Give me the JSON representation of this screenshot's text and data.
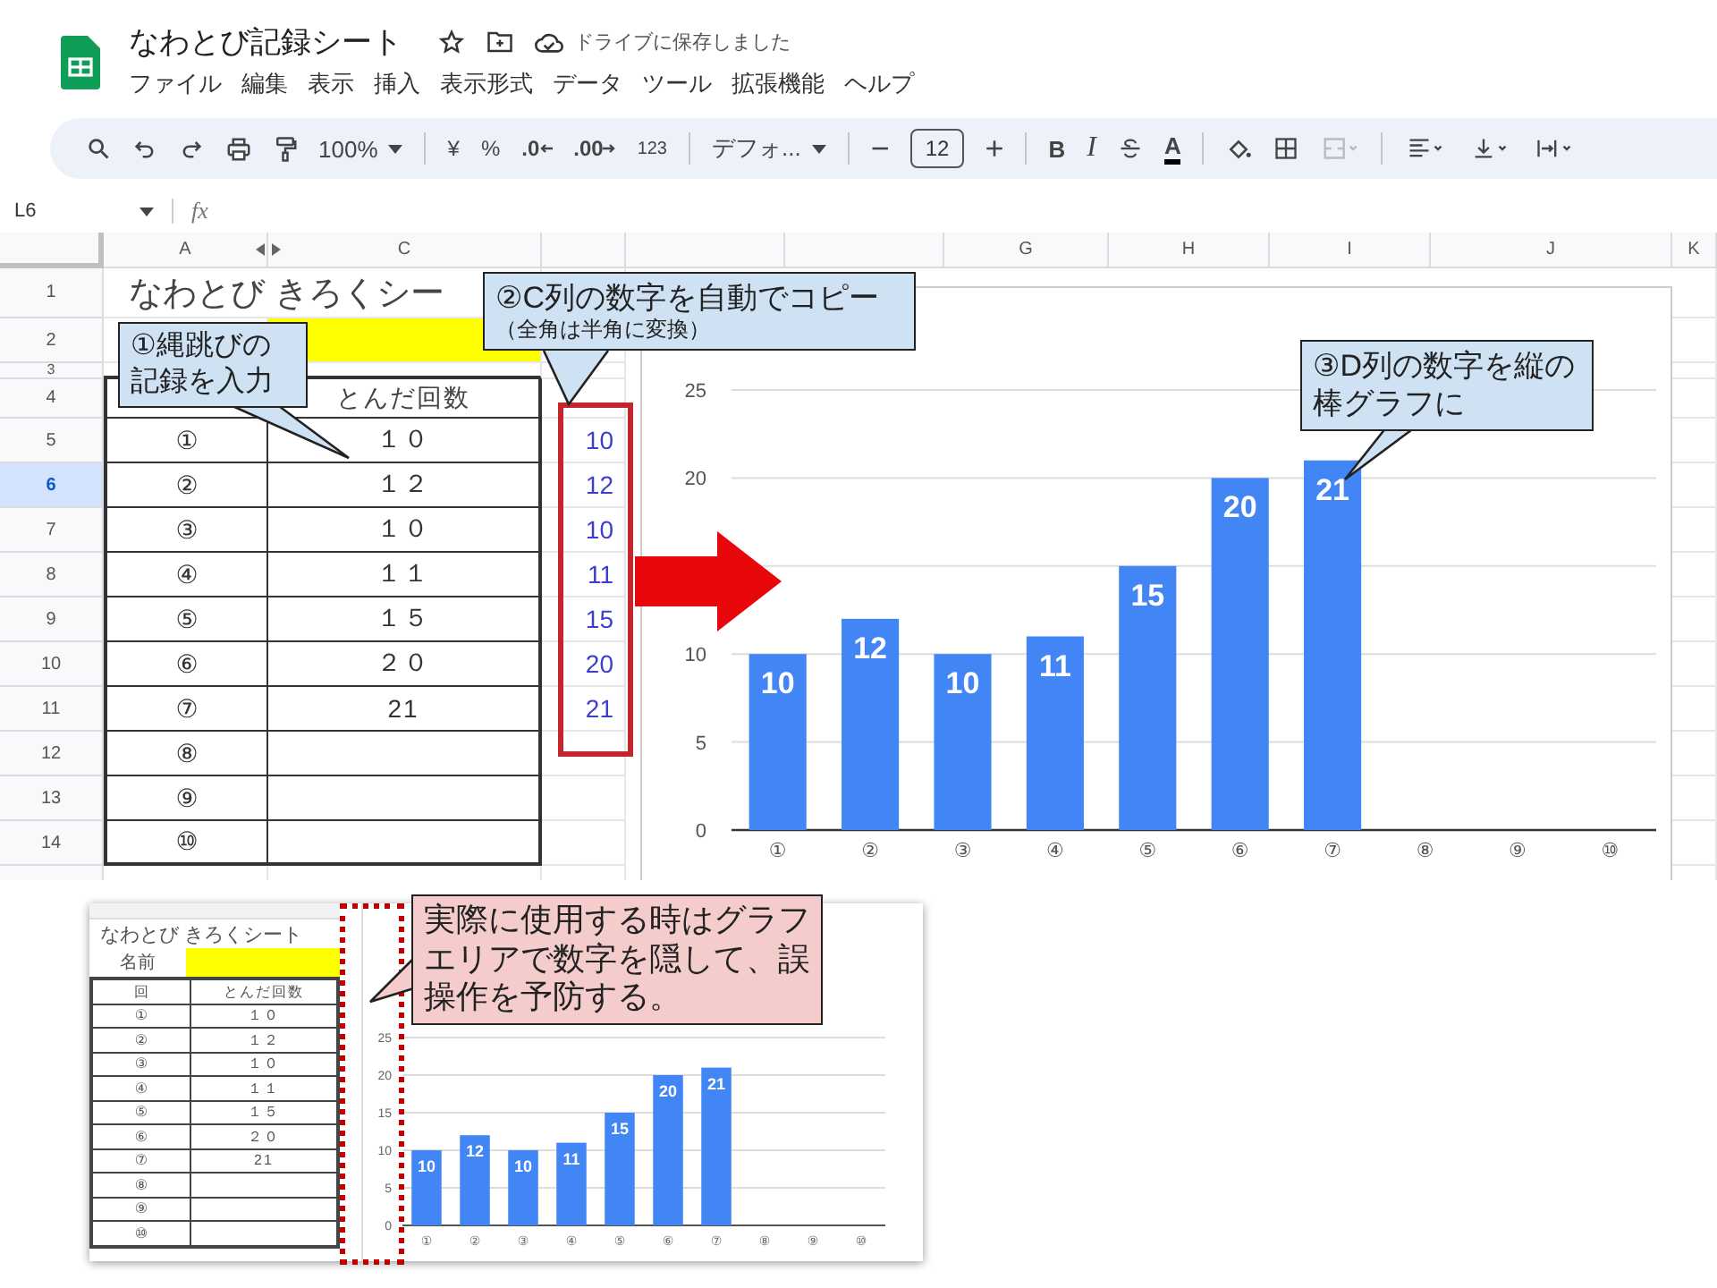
{
  "app": {
    "title": "なわとび記録シート",
    "save_status": "ドライブに保存しました",
    "menu": [
      "ファイル",
      "編集",
      "表示",
      "挿入",
      "表示形式",
      "データ",
      "ツール",
      "拡張機能",
      "ヘルプ"
    ]
  },
  "toolbar": {
    "zoom": "100%",
    "currency": "¥",
    "percent": "%",
    "decimal_decrease": ".0",
    "decimal_increase": ".00",
    "number_format": "123",
    "font": "デフォ...",
    "size_minus": "−",
    "font_size": "12",
    "size_plus": "+",
    "bold": "B",
    "italic": "I",
    "text_color": "A"
  },
  "formula_bar": {
    "cell_ref": "L6",
    "fx": "fx"
  },
  "sheet": {
    "columns": [
      "A",
      "C",
      "G",
      "H",
      "I",
      "J",
      "K"
    ],
    "rows": [
      {
        "number": "1",
        "selected": false
      },
      {
        "number": "2",
        "selected": false
      },
      {
        "number": "3",
        "selected": false
      },
      {
        "number": "4",
        "selected": false
      },
      {
        "number": "5",
        "selected": false
      },
      {
        "number": "6",
        "selected": true
      },
      {
        "number": "7",
        "selected": false
      },
      {
        "number": "8",
        "selected": false
      },
      {
        "number": "9",
        "selected": false
      },
      {
        "number": "10",
        "selected": false
      },
      {
        "number": "11",
        "selected": false
      },
      {
        "number": "12",
        "selected": false
      },
      {
        "number": "13",
        "selected": false
      },
      {
        "number": "14",
        "selected": false
      }
    ],
    "title": "なわとび きろくシー",
    "count_header": "とんだ回数",
    "entries": [
      {
        "round": "①",
        "count": "１０",
        "copied": "10"
      },
      {
        "round": "②",
        "count": "１２",
        "copied": "12"
      },
      {
        "round": "③",
        "count": "１０",
        "copied": "10"
      },
      {
        "round": "④",
        "count": "１１",
        "copied": "11"
      },
      {
        "round": "⑤",
        "count": "１５",
        "copied": "15"
      },
      {
        "round": "⑥",
        "count": "２０",
        "copied": "20"
      },
      {
        "round": "⑦",
        "count": "21",
        "copied": "21"
      },
      {
        "round": "⑧"
      },
      {
        "round": "⑨"
      },
      {
        "round": "⑩"
      }
    ]
  },
  "chart": {
    "chart_data": {
      "type": "bar",
      "categories": [
        "①",
        "②",
        "③",
        "④",
        "⑤",
        "⑥",
        "⑦",
        "⑧",
        "⑨",
        "⑩"
      ],
      "values": [
        10,
        12,
        10,
        11,
        15,
        20,
        21,
        null,
        null,
        null
      ],
      "ylim": [
        0,
        25
      ],
      "yticks": [
        0,
        5,
        10,
        20,
        25
      ],
      "grid": true,
      "data_labels": true
    }
  },
  "callouts": [
    {
      "kind": "info",
      "text": "①縄跳びの記録を入力"
    },
    {
      "kind": "info",
      "text": "②C列の数字を自動でコピー",
      "note": "（全角は半角に変換）"
    },
    {
      "kind": "info",
      "text": "③D列の数字を縦の棒グラフに"
    }
  ],
  "inset": {
    "title": "なわとび きろくシート",
    "name_label": "名前",
    "round_header": "回",
    "count_header": "とんだ回数",
    "entries": [
      {
        "round": "①",
        "count": "１０"
      },
      {
        "round": "②",
        "count": "１２"
      },
      {
        "round": "③",
        "count": "１０"
      },
      {
        "round": "④",
        "count": "１１"
      },
      {
        "round": "⑤",
        "count": "１５"
      },
      {
        "round": "⑥",
        "count": "２０"
      },
      {
        "round": "⑦",
        "count": "21"
      },
      {
        "round": "⑧"
      },
      {
        "round": "⑨"
      },
      {
        "round": "⑩"
      }
    ],
    "chart": {
      "chart_data": {
        "type": "bar",
        "categories": [
          "①",
          "②",
          "③",
          "④",
          "⑤",
          "⑥",
          "⑦",
          "⑧",
          "⑨",
          "⑩"
        ],
        "values": [
          10,
          12,
          10,
          11,
          15,
          20,
          21,
          null,
          null,
          null
        ],
        "ylim": [
          0,
          25
        ],
        "yticks": [
          0,
          5,
          10,
          15,
          20,
          25
        ],
        "grid": true,
        "data_labels": true
      }
    },
    "callout": {
      "kind": "caution",
      "text": "実際に使用する時はグラフエリアで数字を隠して、誤操作を予防する。"
    }
  }
}
